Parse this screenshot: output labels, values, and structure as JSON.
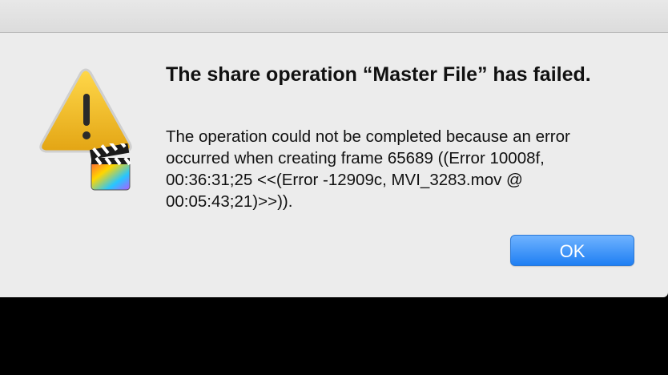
{
  "dialog": {
    "title": "The share operation “Master File” has failed.",
    "message": "The operation could not be completed because an error occurred when creating frame 65689 ((Error 10008f, 00:36:31;25 <<(Error -12909c, MVI_3283.mov @ 00:05:43;21)>>)).",
    "ok_label": "OK",
    "icon": "warning-icon",
    "badge_icon": "final-cut-pro-icon"
  },
  "colors": {
    "dialog_background": "#ececec",
    "button_top": "#6fb3ff",
    "button_bottom": "#1f7ff3",
    "warning_yellow": "#f0b928"
  }
}
